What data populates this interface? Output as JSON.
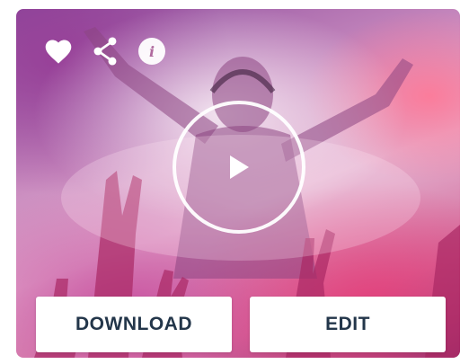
{
  "card": {
    "image_icon": "concert-photo",
    "actions": {
      "favorite_icon": "heart-icon",
      "share_icon": "share-icon",
      "info_icon": "info-icon",
      "info_glyph": "i"
    },
    "play_icon": "play-icon",
    "buttons": {
      "download_label": "DOWNLOAD",
      "edit_label": "EDIT"
    }
  },
  "colors": {
    "button_text": "#23364a",
    "button_bg": "#ffffff",
    "icon": "#ffffff"
  }
}
